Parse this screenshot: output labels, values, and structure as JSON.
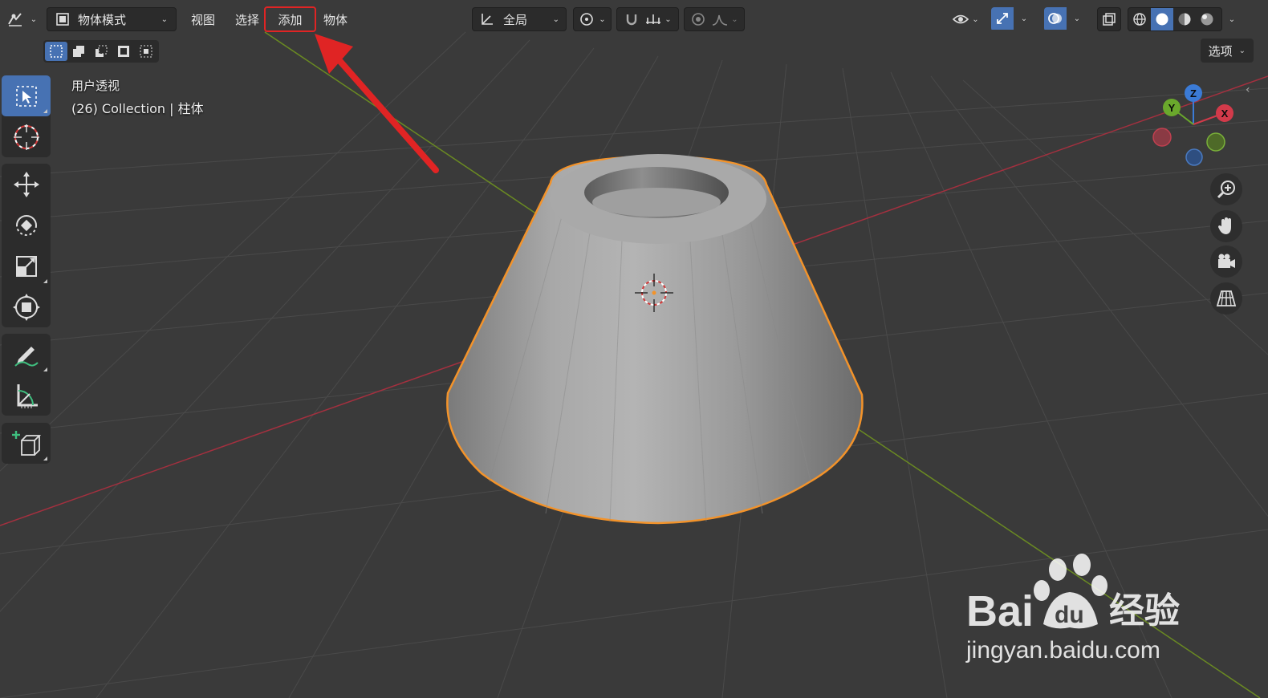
{
  "header": {
    "mode_label": "物体模式",
    "menus": [
      "视图",
      "选择",
      "添加",
      "物体"
    ],
    "highlighted_menu": "添加",
    "orientation_label": "全局",
    "options_label": "选项"
  },
  "viewport": {
    "view_name": "用户透视",
    "collection_info": "(26) Collection | 柱体",
    "gizmo_axes": {
      "x": "X",
      "y": "Y",
      "z": "Z"
    }
  },
  "toolbar": {
    "tools": [
      {
        "name": "select-box",
        "icon": "cursor-arrow-icon",
        "active": true
      },
      {
        "name": "cursor",
        "icon": "3d-cursor-icon",
        "active": false
      },
      {
        "name": "move",
        "icon": "move-icon",
        "active": false
      },
      {
        "name": "rotate",
        "icon": "rotate-icon",
        "active": false
      },
      {
        "name": "scale",
        "icon": "scale-icon",
        "active": false
      },
      {
        "name": "transform",
        "icon": "transform-icon",
        "active": false
      },
      {
        "name": "annotate",
        "icon": "annotate-pen-icon",
        "active": false
      },
      {
        "name": "measure",
        "icon": "ruler-icon",
        "active": false
      },
      {
        "name": "add-cube",
        "icon": "add-cube-icon",
        "active": false
      }
    ]
  },
  "colors": {
    "viewport_bg": "#3a3a3a",
    "grid": "#484848",
    "axis_x": "#a4303f",
    "axis_y": "#6a8a22",
    "selection_outline": "#f3932a",
    "active_blue": "#4772b3",
    "annotation_red": "#e02424"
  },
  "watermark": {
    "brand_left": "Bai",
    "brand_mid": "du",
    "brand_right": "经验",
    "url": "jingyan.baidu.com"
  }
}
